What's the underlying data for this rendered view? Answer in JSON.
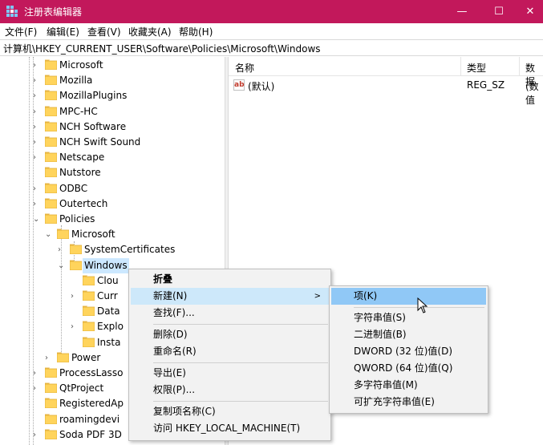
{
  "window": {
    "title": "注册表编辑器",
    "minimize_glyph": "—",
    "maximize_glyph": "☐",
    "close_glyph": "✕",
    "accent_color": "#c2185b"
  },
  "menubar": {
    "items": [
      "文件(F)",
      "编辑(E)",
      "查看(V)",
      "收藏夹(A)",
      "帮助(H)"
    ]
  },
  "address": {
    "path": "计算机\\HKEY_CURRENT_USER\\Software\\Policies\\Microsoft\\Windows"
  },
  "tree": {
    "items": [
      {
        "label": "Microsoft",
        "expander": ">"
      },
      {
        "label": "Mozilla",
        "expander": ">"
      },
      {
        "label": "MozillaPlugins",
        "expander": ">"
      },
      {
        "label": "MPC-HC",
        "expander": ">"
      },
      {
        "label": "NCH Software",
        "expander": ">"
      },
      {
        "label": "NCH Swift Sound",
        "expander": ">"
      },
      {
        "label": "Netscape",
        "expander": ">"
      },
      {
        "label": "Nutstore",
        "expander": ""
      },
      {
        "label": "ODBC",
        "expander": ">"
      },
      {
        "label": "Outertech",
        "expander": ">"
      },
      {
        "label": "Policies",
        "expander": "v"
      },
      {
        "label": "Microsoft",
        "expander": "v"
      },
      {
        "label": "SystemCertificates",
        "expander": ">"
      },
      {
        "label": "Windows",
        "expander": "v"
      },
      {
        "label": "Clou",
        "expander": ""
      },
      {
        "label": "Curr",
        "expander": ">"
      },
      {
        "label": "Data",
        "expander": ""
      },
      {
        "label": "Explo",
        "expander": ">"
      },
      {
        "label": "Insta",
        "expander": ""
      },
      {
        "label": "Power",
        "expander": ">"
      },
      {
        "label": "ProcessLasso",
        "expander": ">"
      },
      {
        "label": "QtProject",
        "expander": ">"
      },
      {
        "label": "RegisteredAp",
        "expander": ""
      },
      {
        "label": "roamingdevi",
        "expander": ""
      },
      {
        "label": "Soda PDF 3D",
        "expander": ">"
      }
    ],
    "selected": "Windows"
  },
  "list": {
    "columns": [
      "名称",
      "类型",
      "数据"
    ],
    "rows": [
      {
        "icon": "ab",
        "name": "(默认)",
        "type": "REG_SZ",
        "data": "(数值"
      }
    ]
  },
  "context_menu": {
    "items": [
      "折叠",
      "新建(N)",
      "查找(F)...",
      "删除(D)",
      "重命名(R)",
      "导出(E)",
      "权限(P)...",
      "复制项名称(C)",
      "访问 HKEY_LOCAL_MACHINE(T)"
    ],
    "submenu_arrow": ">",
    "highlighted": "新建(N)"
  },
  "submenu": {
    "items": [
      "项(K)",
      "字符串值(S)",
      "二进制值(B)",
      "DWORD (32 位)值(D)",
      "QWORD (64 位)值(Q)",
      "多字符串值(M)",
      "可扩充字符串值(E)"
    ],
    "highlighted": "项(K)"
  }
}
